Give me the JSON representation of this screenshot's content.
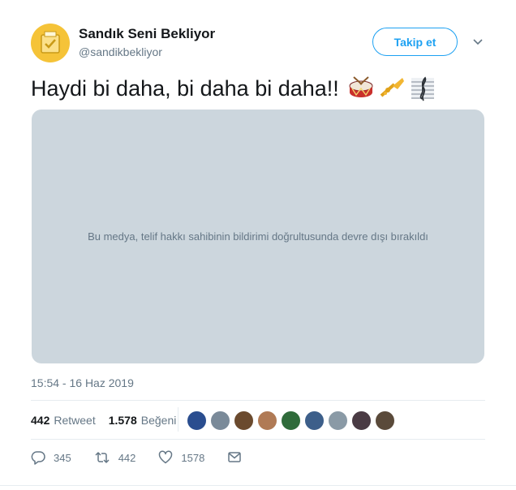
{
  "user": {
    "name": "Sandık Seni Bekliyor",
    "handle": "@sandikbekliyor",
    "avatar_color": "#f5c338"
  },
  "follow_button": {
    "label": "Takip et"
  },
  "tweet": {
    "text": "Haydi bi daha, bi daha bi daha!!",
    "emojis": [
      "drum-icon",
      "trumpet-icon",
      "musical-score-icon"
    ]
  },
  "media": {
    "message": "Bu medya, telif hakkı sahibinin bildirimi doğrultusunda devre dışı bırakıldı"
  },
  "timestamp": "15:54 - 16 Haz 2019",
  "stats": {
    "retweets_count": "442",
    "retweets_label": "Retweet",
    "likes_count": "1.578",
    "likes_label": "Beğeni"
  },
  "liker_avatars": [
    {
      "color": "#2a4d8f"
    },
    {
      "color": "#7a8a99"
    },
    {
      "color": "#6b4a2e"
    },
    {
      "color": "#b07a55"
    },
    {
      "color": "#2f6b3a"
    },
    {
      "color": "#3d5f8a"
    },
    {
      "color": "#8a9aa6"
    },
    {
      "color": "#4a3b44"
    },
    {
      "color": "#5a4a3a"
    }
  ],
  "actions": {
    "reply_count": "345",
    "retweet_count": "442",
    "like_count": "1578"
  },
  "colors": {
    "accent": "#1da1f2",
    "muted_text": "#657786",
    "media_bg": "#ccd6dd"
  }
}
